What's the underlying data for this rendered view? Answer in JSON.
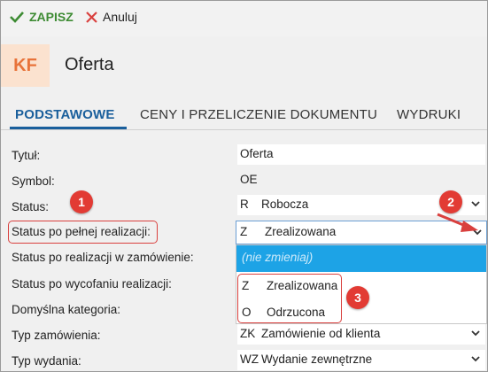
{
  "toolbar": {
    "save_label": "ZAPISZ",
    "cancel_label": "Anuluj"
  },
  "header": {
    "initials": "KF",
    "title": "Oferta"
  },
  "tabs": [
    {
      "label": "PODSTAWOWE",
      "active": true
    },
    {
      "label": "CENY I PRZELICZENIE DOKUMENTU",
      "active": false
    },
    {
      "label": "WYDRUKI",
      "active": false
    }
  ],
  "fields": {
    "title": {
      "label": "Tytuł:",
      "value": "Oferta"
    },
    "symbol": {
      "label": "Symbol:",
      "value": "OE"
    },
    "status": {
      "label": "Status:",
      "code": "R",
      "value": "Robocza"
    },
    "status_full": {
      "label": "Status po pełnej realizacji:",
      "code": "Z",
      "value": "Zrealizowana"
    },
    "status_order": {
      "label": "Status po realizacji w zamówienie:"
    },
    "status_withdraw": {
      "label": "Status po wycofaniu realizacji:"
    },
    "default_category": {
      "label": "Domyślna kategoria:"
    },
    "order_type": {
      "label": "Typ zamówienia:",
      "code": "ZK",
      "value": "Zamówienie od klienta"
    },
    "issue_type": {
      "label": "Typ wydania:",
      "code": "WZ",
      "value": "Wydanie zewnętrzne"
    }
  },
  "dropdown": {
    "options": [
      {
        "code": "",
        "label": "(nie zmieniaj)",
        "highlighted": true
      },
      {
        "code": "Z",
        "label": "Zrealizowana"
      },
      {
        "code": "O",
        "label": "Odrzucona"
      }
    ]
  },
  "badges": [
    "1",
    "2",
    "3"
  ],
  "colors": {
    "accent": "#1a5f9c",
    "save_green": "#3d8b33",
    "highlight_red": "#d9403e",
    "selection_blue": "#1da3e6",
    "kf_bg": "#fbe2cf",
    "kf_text": "#e8733a"
  }
}
